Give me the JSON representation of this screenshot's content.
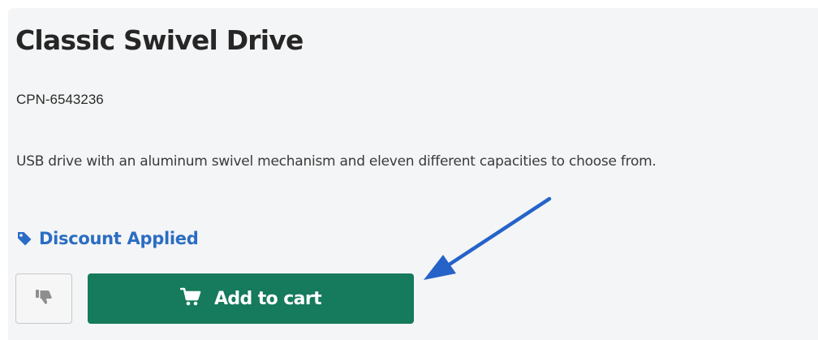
{
  "product": {
    "title": "Classic Swivel Drive",
    "cpn": "CPN-6543236",
    "description": "USB drive with an aluminum swivel mechanism and eleven different capacities to choose from.",
    "discount_label": "Discount Applied"
  },
  "actions": {
    "add_to_cart_label": "Add to cart",
    "dislike_icon": "thumbs-down-icon",
    "cart_icon": "shopping-cart-icon"
  },
  "colors": {
    "cart_button": "#167a5c",
    "discount_text": "#2b6dc4",
    "annotation_arrow": "#2563c9",
    "card_background": "#f4f5f6"
  }
}
